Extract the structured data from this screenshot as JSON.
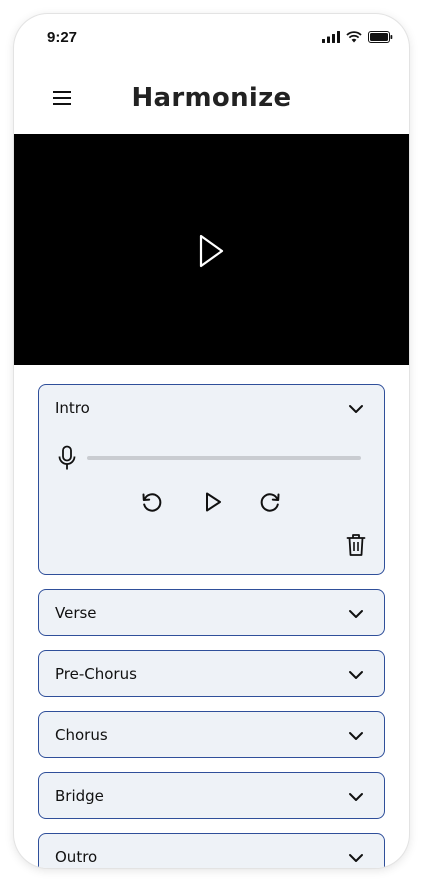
{
  "status_bar": {
    "time": "9:27",
    "icons": [
      "signal-icon",
      "wifi-icon",
      "battery-icon"
    ]
  },
  "app_bar": {
    "title": "Harmonize",
    "menu_icon": "hamburger-menu-icon"
  },
  "video": {
    "play_icon": "play-icon"
  },
  "sections": [
    {
      "label": "Intro",
      "expanded": true,
      "recording_progress": 0,
      "controls": [
        "rewind-icon",
        "play-icon",
        "forward-icon"
      ],
      "delete_icon": "trash-icon"
    },
    {
      "label": "Verse",
      "expanded": false
    },
    {
      "label": "Pre-Chorus",
      "expanded": false
    },
    {
      "label": "Chorus",
      "expanded": false
    },
    {
      "label": "Bridge",
      "expanded": false
    },
    {
      "label": "Outro",
      "expanded": false
    }
  ],
  "colors": {
    "card_border": "#2f4f9a",
    "card_background": "#eef2f7",
    "video_background": "#000000",
    "progress_track": "#c9ccd1"
  }
}
